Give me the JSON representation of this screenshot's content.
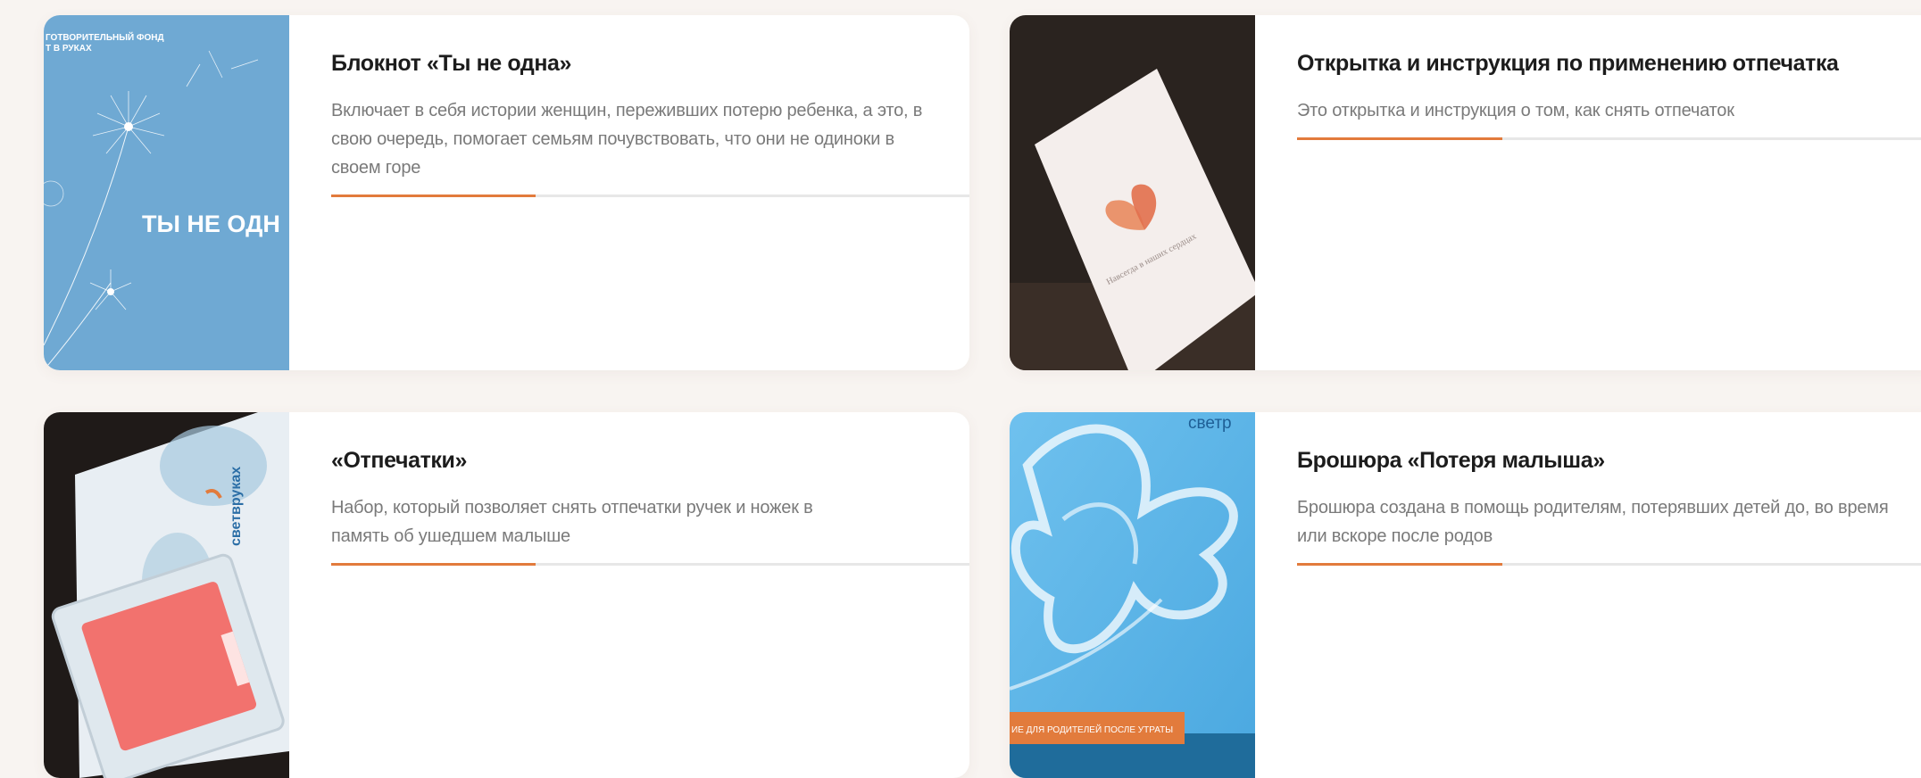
{
  "colors": {
    "accent": "#e27b3c",
    "page_background": "#f8f4f1",
    "card_background": "#ffffff",
    "title": "#1c1c1c",
    "text_muted": "#7a7a7a"
  },
  "cards": [
    {
      "title": "Блокнот «Ты не одна»",
      "description": "Включает в себя истории женщин, переживших потерю ребенка, а это, в свою очередь, помогает семьям почувствовать, что они не одиноки в своем горе",
      "progress": 0.32,
      "image": {
        "kind": "notebook-cover",
        "overlay_top": "ГОТВОРИТЕЛЬНЫЙ ФОНД\nТ В РУКАХ",
        "overlay_main": "ТЫ НЕ ОДН"
      }
    },
    {
      "title": "Открытка и инструкция по применению отпечатка",
      "description": "Это открытка и инструкция о том, как снять отпечаток",
      "progress": 0.32,
      "image": {
        "kind": "postcard-photo"
      }
    },
    {
      "title": "«Отпечатки»",
      "description": "Набор, который позволяет снять отпечатки ручек и ножек в память об ушедшем малыше",
      "progress": 0.32,
      "image": {
        "kind": "imprint-kit-photo"
      }
    },
    {
      "title": "Брошюра «Потеря малыша»",
      "description": "Брошюра создана в помощь родителям, потерявших детей до, во время или вскоре после родов",
      "progress": 0.32,
      "image": {
        "kind": "brochure-cover",
        "overlay_brand": "светр",
        "overlay_banner": "ИЕ ДЛЯ РОДИТЕЛЕЙ ПОСЛЕ УТРАТЫ"
      }
    }
  ]
}
